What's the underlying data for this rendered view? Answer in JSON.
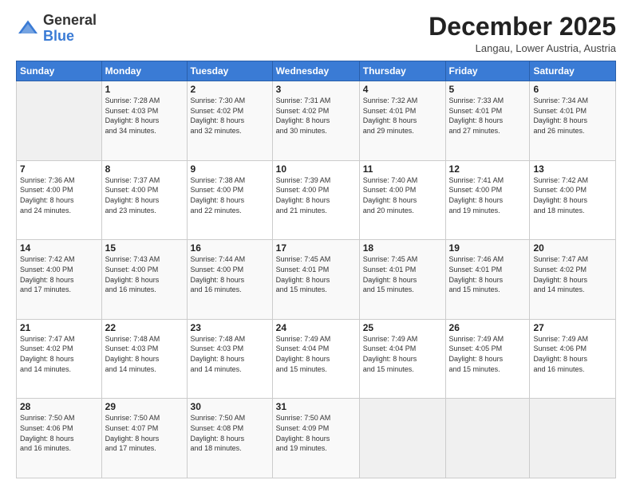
{
  "logo": {
    "general": "General",
    "blue": "Blue"
  },
  "header": {
    "month": "December 2025",
    "location": "Langau, Lower Austria, Austria"
  },
  "weekdays": [
    "Sunday",
    "Monday",
    "Tuesday",
    "Wednesday",
    "Thursday",
    "Friday",
    "Saturday"
  ],
  "weeks": [
    [
      {
        "day": "",
        "info": ""
      },
      {
        "day": "1",
        "info": "Sunrise: 7:28 AM\nSunset: 4:03 PM\nDaylight: 8 hours\nand 34 minutes."
      },
      {
        "day": "2",
        "info": "Sunrise: 7:30 AM\nSunset: 4:02 PM\nDaylight: 8 hours\nand 32 minutes."
      },
      {
        "day": "3",
        "info": "Sunrise: 7:31 AM\nSunset: 4:02 PM\nDaylight: 8 hours\nand 30 minutes."
      },
      {
        "day": "4",
        "info": "Sunrise: 7:32 AM\nSunset: 4:01 PM\nDaylight: 8 hours\nand 29 minutes."
      },
      {
        "day": "5",
        "info": "Sunrise: 7:33 AM\nSunset: 4:01 PM\nDaylight: 8 hours\nand 27 minutes."
      },
      {
        "day": "6",
        "info": "Sunrise: 7:34 AM\nSunset: 4:01 PM\nDaylight: 8 hours\nand 26 minutes."
      }
    ],
    [
      {
        "day": "7",
        "info": "Sunrise: 7:36 AM\nSunset: 4:00 PM\nDaylight: 8 hours\nand 24 minutes."
      },
      {
        "day": "8",
        "info": "Sunrise: 7:37 AM\nSunset: 4:00 PM\nDaylight: 8 hours\nand 23 minutes."
      },
      {
        "day": "9",
        "info": "Sunrise: 7:38 AM\nSunset: 4:00 PM\nDaylight: 8 hours\nand 22 minutes."
      },
      {
        "day": "10",
        "info": "Sunrise: 7:39 AM\nSunset: 4:00 PM\nDaylight: 8 hours\nand 21 minutes."
      },
      {
        "day": "11",
        "info": "Sunrise: 7:40 AM\nSunset: 4:00 PM\nDaylight: 8 hours\nand 20 minutes."
      },
      {
        "day": "12",
        "info": "Sunrise: 7:41 AM\nSunset: 4:00 PM\nDaylight: 8 hours\nand 19 minutes."
      },
      {
        "day": "13",
        "info": "Sunrise: 7:42 AM\nSunset: 4:00 PM\nDaylight: 8 hours\nand 18 minutes."
      }
    ],
    [
      {
        "day": "14",
        "info": "Sunrise: 7:42 AM\nSunset: 4:00 PM\nDaylight: 8 hours\nand 17 minutes."
      },
      {
        "day": "15",
        "info": "Sunrise: 7:43 AM\nSunset: 4:00 PM\nDaylight: 8 hours\nand 16 minutes."
      },
      {
        "day": "16",
        "info": "Sunrise: 7:44 AM\nSunset: 4:00 PM\nDaylight: 8 hours\nand 16 minutes."
      },
      {
        "day": "17",
        "info": "Sunrise: 7:45 AM\nSunset: 4:01 PM\nDaylight: 8 hours\nand 15 minutes."
      },
      {
        "day": "18",
        "info": "Sunrise: 7:45 AM\nSunset: 4:01 PM\nDaylight: 8 hours\nand 15 minutes."
      },
      {
        "day": "19",
        "info": "Sunrise: 7:46 AM\nSunset: 4:01 PM\nDaylight: 8 hours\nand 15 minutes."
      },
      {
        "day": "20",
        "info": "Sunrise: 7:47 AM\nSunset: 4:02 PM\nDaylight: 8 hours\nand 14 minutes."
      }
    ],
    [
      {
        "day": "21",
        "info": "Sunrise: 7:47 AM\nSunset: 4:02 PM\nDaylight: 8 hours\nand 14 minutes."
      },
      {
        "day": "22",
        "info": "Sunrise: 7:48 AM\nSunset: 4:03 PM\nDaylight: 8 hours\nand 14 minutes."
      },
      {
        "day": "23",
        "info": "Sunrise: 7:48 AM\nSunset: 4:03 PM\nDaylight: 8 hours\nand 14 minutes."
      },
      {
        "day": "24",
        "info": "Sunrise: 7:49 AM\nSunset: 4:04 PM\nDaylight: 8 hours\nand 15 minutes."
      },
      {
        "day": "25",
        "info": "Sunrise: 7:49 AM\nSunset: 4:04 PM\nDaylight: 8 hours\nand 15 minutes."
      },
      {
        "day": "26",
        "info": "Sunrise: 7:49 AM\nSunset: 4:05 PM\nDaylight: 8 hours\nand 15 minutes."
      },
      {
        "day": "27",
        "info": "Sunrise: 7:49 AM\nSunset: 4:06 PM\nDaylight: 8 hours\nand 16 minutes."
      }
    ],
    [
      {
        "day": "28",
        "info": "Sunrise: 7:50 AM\nSunset: 4:06 PM\nDaylight: 8 hours\nand 16 minutes."
      },
      {
        "day": "29",
        "info": "Sunrise: 7:50 AM\nSunset: 4:07 PM\nDaylight: 8 hours\nand 17 minutes."
      },
      {
        "day": "30",
        "info": "Sunrise: 7:50 AM\nSunset: 4:08 PM\nDaylight: 8 hours\nand 18 minutes."
      },
      {
        "day": "31",
        "info": "Sunrise: 7:50 AM\nSunset: 4:09 PM\nDaylight: 8 hours\nand 19 minutes."
      },
      {
        "day": "",
        "info": ""
      },
      {
        "day": "",
        "info": ""
      },
      {
        "day": "",
        "info": ""
      }
    ]
  ]
}
